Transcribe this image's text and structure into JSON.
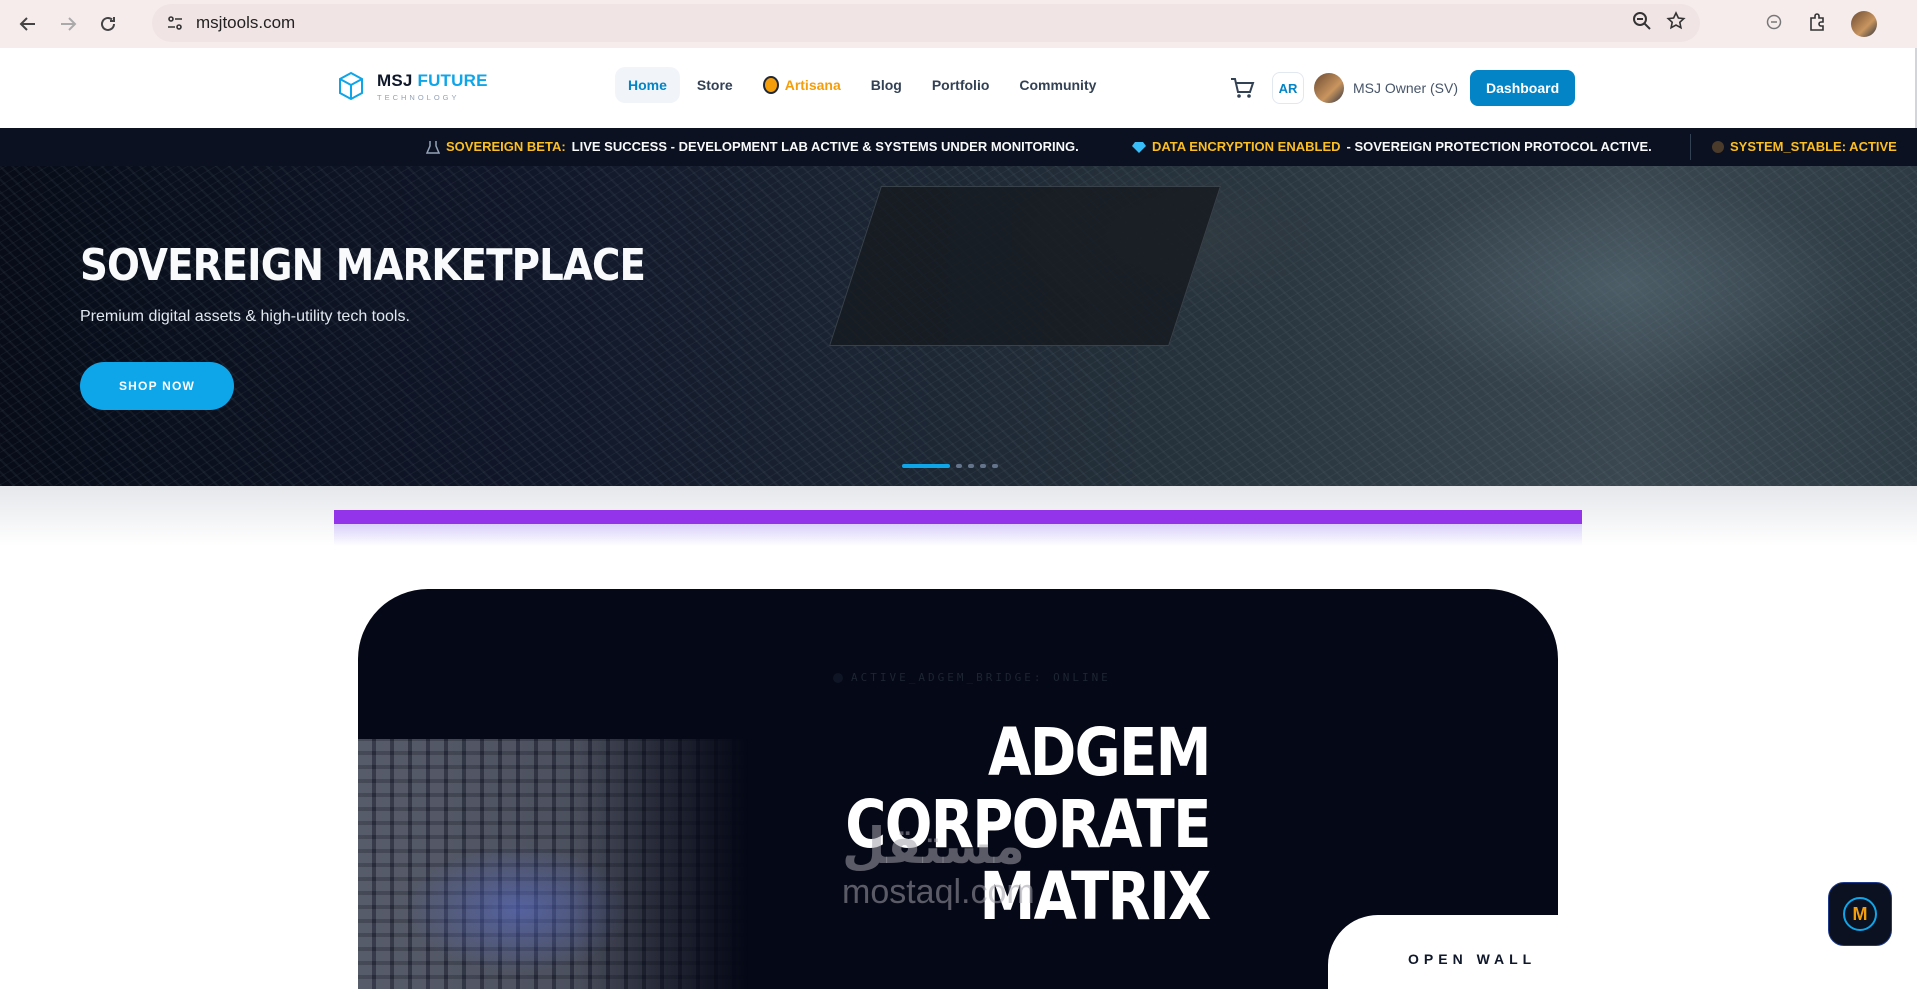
{
  "browser": {
    "url": "msjtools.com",
    "icons": [
      "back-icon",
      "forward-icon",
      "reload-icon",
      "site-info-icon",
      "zoom-icon",
      "bookmark-star-icon",
      "chat-icon",
      "extensions-icon",
      "profile-avatar"
    ]
  },
  "header": {
    "logo_main": "MSJ",
    "logo_accent": "FUTURE",
    "logo_sub": "TECHNOLOGY",
    "nav": [
      {
        "label": "Home",
        "active": true
      },
      {
        "label": "Store"
      },
      {
        "label": "Artisana"
      },
      {
        "label": "Blog"
      },
      {
        "label": "Portfolio"
      },
      {
        "label": "Community"
      }
    ],
    "lang": "AR",
    "user_name": "MSJ Owner (SV)",
    "dashboard_label": "Dashboard"
  },
  "ticker": {
    "items": [
      {
        "label": "SOVEREIGN BETA:",
        "message": "LIVE SUCCESS - DEVELOPMENT LAB ACTIVE & SYSTEMS UNDER MONITORING."
      },
      {
        "label": "DATA ENCRYPTION ENABLED",
        "message": "- SOVEREIGN PROTECTION PROTOCOL ACTIVE."
      },
      {
        "label": "SYSTEM_STABLE: ACTIVE",
        "message": ""
      }
    ]
  },
  "hero": {
    "title": "SOVEREIGN MARKETPLACE",
    "subtitle": "Premium digital assets & high-utility tech tools.",
    "cta": "SHOP NOW",
    "slide_count": 5,
    "active_slide": 1
  },
  "matrix": {
    "status": "ACTIVE_ADGEM_BRIDGE: ONLINE",
    "title_lines": [
      "ADGEM",
      "CORPORATE",
      "MATRIX"
    ],
    "open_wall": "OPEN WALL"
  },
  "watermark": {
    "arabic": "مستقل",
    "latin": "mostaql.com"
  },
  "colors": {
    "brand": "#0284c7",
    "accent": "#0ea5e9",
    "ticker_label": "#fbbf24",
    "purple_bar": "#9333ea",
    "dark": "#050816"
  }
}
